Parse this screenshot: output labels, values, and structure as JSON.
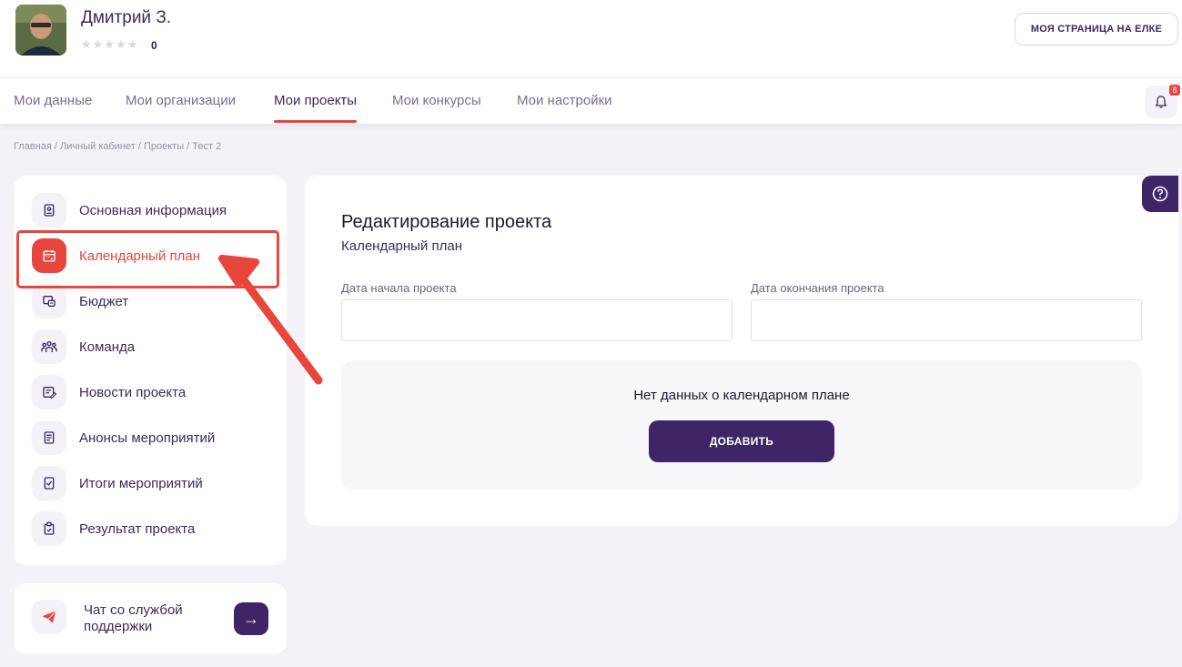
{
  "user": {
    "name": "Дмитрий З.",
    "rating_count": "0",
    "stars_total": 5,
    "stars_filled": 0
  },
  "header": {
    "my_page_button": "МОЯ СТРАНИЦА НА ЕЛКЕ",
    "notifications_count": "8"
  },
  "nav": {
    "tabs": [
      {
        "label": "Мои данные",
        "active": false
      },
      {
        "label": "Мои организации",
        "active": false
      },
      {
        "label": "Мои проекты",
        "active": true
      },
      {
        "label": "Мои конкурсы",
        "active": false
      },
      {
        "label": "Мои настройки",
        "active": false
      }
    ]
  },
  "breadcrumb": "Главная / Личный кабинет / Проекты / Тест 2",
  "sidebar": {
    "items": [
      {
        "label": "Основная информация",
        "icon": "document-icon",
        "active": false
      },
      {
        "label": "Календарный план",
        "icon": "calendar-icon",
        "active": true
      },
      {
        "label": "Бюджет",
        "icon": "budget-icon",
        "active": false
      },
      {
        "label": "Команда",
        "icon": "team-icon",
        "active": false
      },
      {
        "label": "Новости проекта",
        "icon": "news-icon",
        "active": false
      },
      {
        "label": "Анонсы мероприятий",
        "icon": "announcement-icon",
        "active": false
      },
      {
        "label": "Итоги мероприятий",
        "icon": "checklist-icon",
        "active": false
      },
      {
        "label": "Результат проекта",
        "icon": "clipboard-icon",
        "active": false
      }
    ]
  },
  "chat": {
    "label": "Чат со службой поддержки",
    "arrow": "→"
  },
  "main": {
    "title": "Редактирование проекта",
    "subtitle": "Календарный план",
    "start_date_label": "Дата начала проекта",
    "start_date_value": "",
    "end_date_label": "Дата окончания проекта",
    "end_date_value": "",
    "empty_text": "Нет данных о календарном плане",
    "add_button": "ДОБАВИТЬ"
  },
  "colors": {
    "accent": "#e8453c",
    "primary": "#3e2565",
    "text": "#3b2a5e"
  }
}
